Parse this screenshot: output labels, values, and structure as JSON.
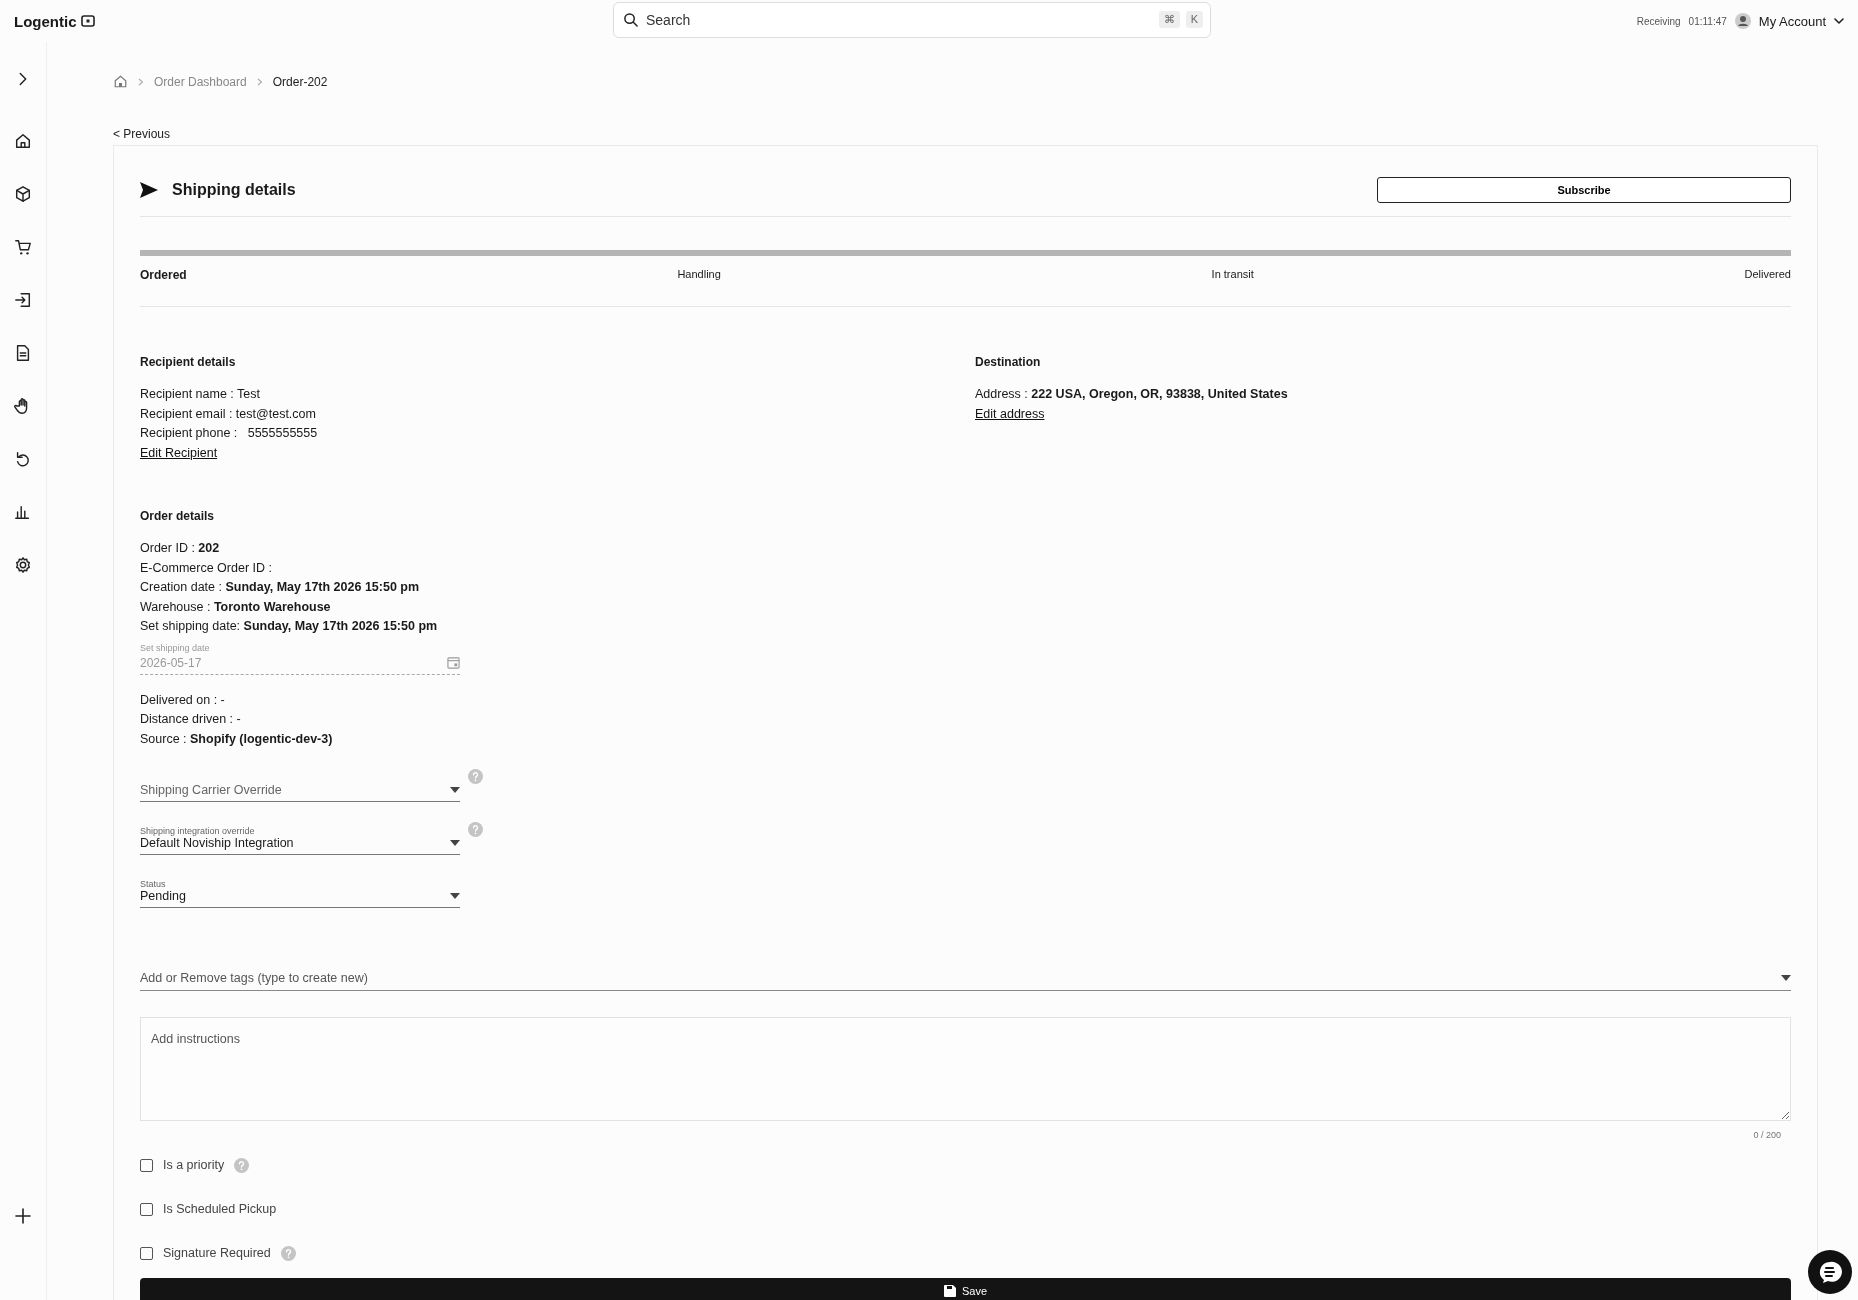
{
  "header": {
    "logo": "Logentic",
    "search": {
      "placeholder": "Search",
      "keys": [
        "⌘",
        "K"
      ]
    },
    "receiving": {
      "label": "Receiving",
      "time": "01:11:47"
    },
    "account": "My Account"
  },
  "breadcrumb": [
    "Order Dashboard",
    "Order-202"
  ],
  "back_link": "< Previous",
  "card": {
    "title": "Shipping details",
    "subscribe": "Subscribe",
    "steps": [
      {
        "label": "Ordered",
        "selected": true
      },
      {
        "label": "Handling",
        "selected": false
      },
      {
        "label": "In transit",
        "selected": false
      },
      {
        "label": "Delivered",
        "selected": false
      }
    ],
    "recipient": {
      "heading": "Recipient details",
      "lines": [
        "Recipient name : Test",
        "Recipient email : test@test.com",
        "Recipient phone :   5555555555"
      ],
      "link": "Edit Recipient"
    },
    "destination": {
      "heading": "Destination",
      "lines": [
        "Address : **222 USA, Oregon, OR, 93838, United States**"
      ],
      "link": "Edit address"
    },
    "order": {
      "heading": "Order details",
      "lines": [
        "Order ID : **202**",
        "E-Commerce Order ID :",
        "Creation date : **Sunday, May 17th 2026 15:50 pm**",
        "Warehouse : **Toronto Warehouse**",
        "Set shipping date: **Sunday, May 17th 2026 15:50 pm**"
      ],
      "date_field": {
        "label": "Set shipping date",
        "value": "2026-05-17",
        "disabled": true
      },
      "more_lines": [
        "Delivered on : -",
        "Distance driven : -",
        "Source : **Shopify (logentic-dev-3)**"
      ],
      "selects": [
        {
          "placeholder": "Shipping Carrier Override",
          "help": true
        },
        {
          "label": "Shipping integration override",
          "value": "Default Noviship Integration",
          "help": true
        },
        {
          "label": "Status",
          "value": "Pending",
          "help": false
        }
      ]
    },
    "tags": {
      "placeholder": "Add or Remove tags (type to create new)"
    },
    "instructions": {
      "placeholder": "Add instructions",
      "counter": "0 / 200"
    },
    "checkboxes": [
      {
        "label": "Is a priority",
        "checked": false,
        "help": true
      },
      {
        "label": "Is Scheduled Pickup",
        "checked": false,
        "help": false
      },
      {
        "label": "Signature Required",
        "checked": false,
        "help": true
      }
    ],
    "save": "Save"
  }
}
